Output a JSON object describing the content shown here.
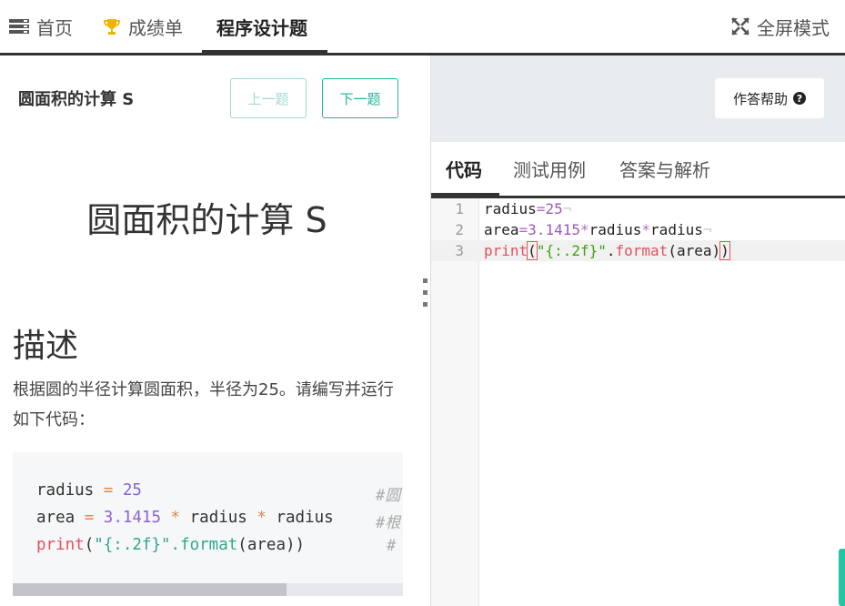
{
  "nav": {
    "home": "首页",
    "grades": "成绩单",
    "programming": "程序设计题",
    "fullscreen": "全屏模式"
  },
  "question": {
    "title": "圆面积的计算 S",
    "prev": "上一题",
    "next": "下一题",
    "big_title": "圆面积的计算 S",
    "desc_heading": "描述",
    "desc_text": "根据圆的半径计算圆面积，半径为25。请编写并运行如下代码：",
    "sample_code": [
      "radius = 25",
      "area = 3.1415 * radius * radius",
      "print(\"{:.2f}\".format(area))"
    ],
    "comment_prefix": [
      "#圆",
      "#根",
      "#"
    ]
  },
  "editor": {
    "help": "作答帮助",
    "tabs": [
      "代码",
      "测试用例",
      "答案与解析"
    ],
    "line_numbers": [
      "1",
      "2",
      "3"
    ],
    "code_lines": [
      "radius=25",
      "area=3.1415*radius*radius",
      "print(\"{:.2f}\".format(area))"
    ]
  },
  "colors": {
    "accent": "#23b59c",
    "dark": "#333333"
  }
}
